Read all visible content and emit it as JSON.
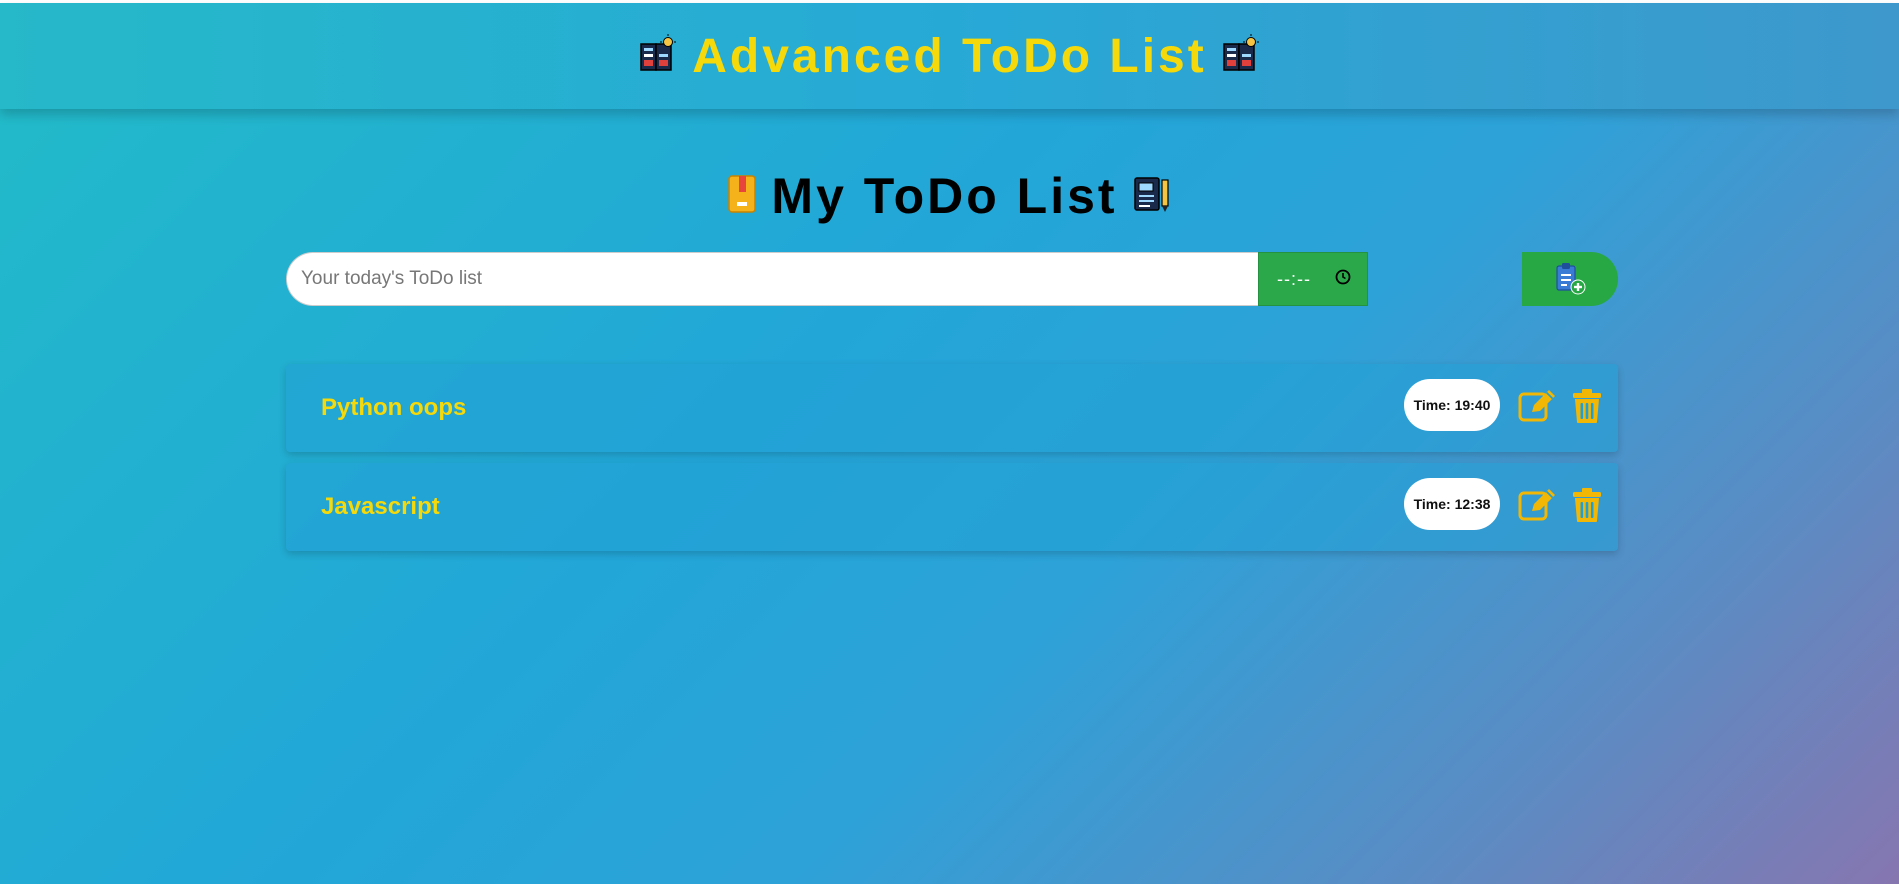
{
  "header": {
    "title": "Advanced ToDo List",
    "left_icon": "notebook-lightbulb-icon",
    "right_icon": "notebook-lightbulb-icon"
  },
  "main": {
    "heading": "My ToDo List",
    "left_icon": "book-icon",
    "right_icon": "notebook-pen-icon"
  },
  "input": {
    "placeholder": "Your today's ToDo list",
    "value": "",
    "time_placeholder": "--:--",
    "time_icon": "clock-icon",
    "add_icon": "clipboard-add-icon"
  },
  "todos": [
    {
      "name": "Python oops",
      "time_label": "Time: 19:40"
    },
    {
      "name": "Javascript",
      "time_label": "Time: 12:38"
    }
  ],
  "colors": {
    "accent": "#f5d90a",
    "button_green": "#28a745",
    "icon_yellow": "#f2b705"
  }
}
